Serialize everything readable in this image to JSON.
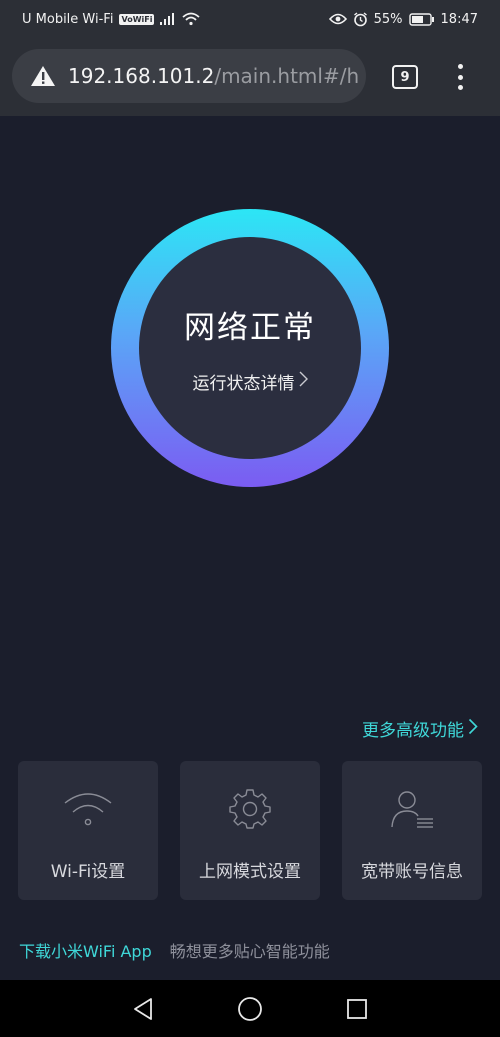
{
  "status_bar": {
    "carrier": "U Mobile Wi-Fi",
    "volte": "VoWiFi",
    "battery": "55%",
    "time": "18:47"
  },
  "browser": {
    "url_host": "192.168.101.2",
    "url_path": "/main.html#/h",
    "tab_count": "9"
  },
  "status_ring": {
    "title": "网络正常",
    "details_link": "运行状态详情"
  },
  "more_features": "更多高级功能",
  "cards": [
    {
      "label": "Wi-Fi设置",
      "icon": "wifi-icon"
    },
    {
      "label": "上网模式设置",
      "icon": "gear-icon"
    },
    {
      "label": "宽带账号信息",
      "icon": "user-account-icon"
    }
  ],
  "footer": {
    "app_link": "下载小米WiFi App",
    "app_desc": "畅想更多贴心智能功能"
  },
  "colors": {
    "accent": "#3fd7d8",
    "background": "#1b1e2c",
    "card": "#2a2d3b",
    "ring_top": "#2ce6f5",
    "ring_bottom": "#7b5cf2"
  }
}
